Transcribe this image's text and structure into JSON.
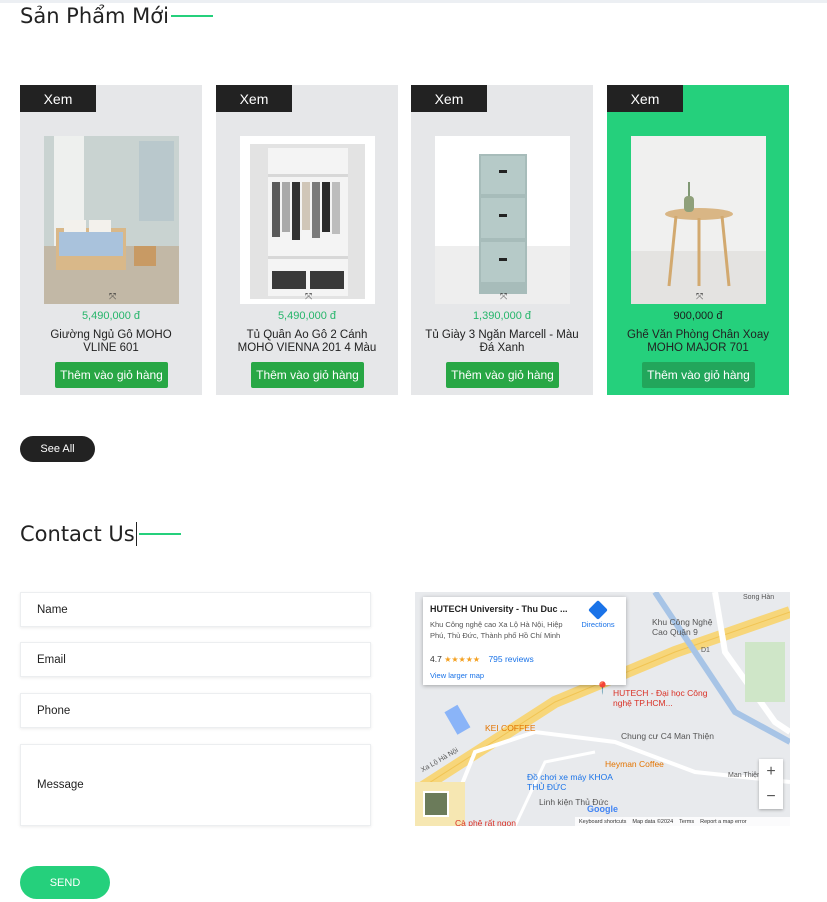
{
  "products_section": {
    "title": "Sản Phẩm Mới",
    "see_all": "See All",
    "products": [
      {
        "tag": "Xem",
        "price": "5,490,000 đ",
        "name": "Giường Ngủ Gỗ MOHO VLINE 601",
        "button": "Thêm vào giỏ hàng"
      },
      {
        "tag": "Xem",
        "price": "5,490,000 đ",
        "name": "Tủ Quần Áo Gỗ 2 Cánh MOHO VIENNA 201 4 Màu",
        "button": "Thêm vào giỏ hàng"
      },
      {
        "tag": "Xem",
        "price": "1,390,000 đ",
        "name": "Tủ Giày 3 Ngăn Marcell - Màu Đá Xanh",
        "button": "Thêm vào giỏ hàng"
      },
      {
        "tag": "Xem",
        "price": "900,000 đ",
        "name": "Ghế Văn Phòng Chân Xoay MOHO MAJOR 701",
        "button": "Thêm vào giỏ hàng"
      }
    ]
  },
  "contact_section": {
    "title": "Contact Us",
    "fields": {
      "name": "Name",
      "email": "Email",
      "phone": "Phone",
      "message": "Message"
    },
    "send": "SEND"
  },
  "map": {
    "place_title": "HUTECH University - Thu Duc ...",
    "address": "Khu Công nghệ cao Xa Lộ Hà Nội, Hiệp Phú, Thủ Đức, Thành phố Hồ Chí Minh",
    "directions": "Directions",
    "rating": "4.7",
    "stars": "★★★★★",
    "reviews": "795 reviews",
    "view_larger": "View larger map",
    "labels": {
      "hutech": "HUTECH - Đại học Công nghệ TP.HCM...",
      "khu_cong_nghe": "Khu Công Nghệ Cao Quận 9",
      "kei_coffee": "KEI COFFEE",
      "chung_cu": "Chung cư C4 Man Thiện",
      "heyman": "Heyman Coffee",
      "do_choi": "Đồ chơi xe máy KHOA THỦ ĐỨC",
      "linh_kien": "Linh kiện Thủ Đức",
      "ca_phe": "Cà phê rất ngon",
      "song_han": "Song Hàn",
      "xa_lo": "Xa Lộ Hà Nội",
      "man_thien": "Man Thiện",
      "d1": "D1"
    },
    "zoom_in": "+",
    "zoom_out": "−",
    "google": "Google",
    "footer": [
      "Keyboard shortcuts",
      "Map data ©2024",
      "Terms",
      "Report a map error"
    ]
  },
  "colors": {
    "accent": "#25d07c",
    "button_green": "#28a745",
    "dark": "#222222",
    "card_bg": "#e6e7e9"
  }
}
